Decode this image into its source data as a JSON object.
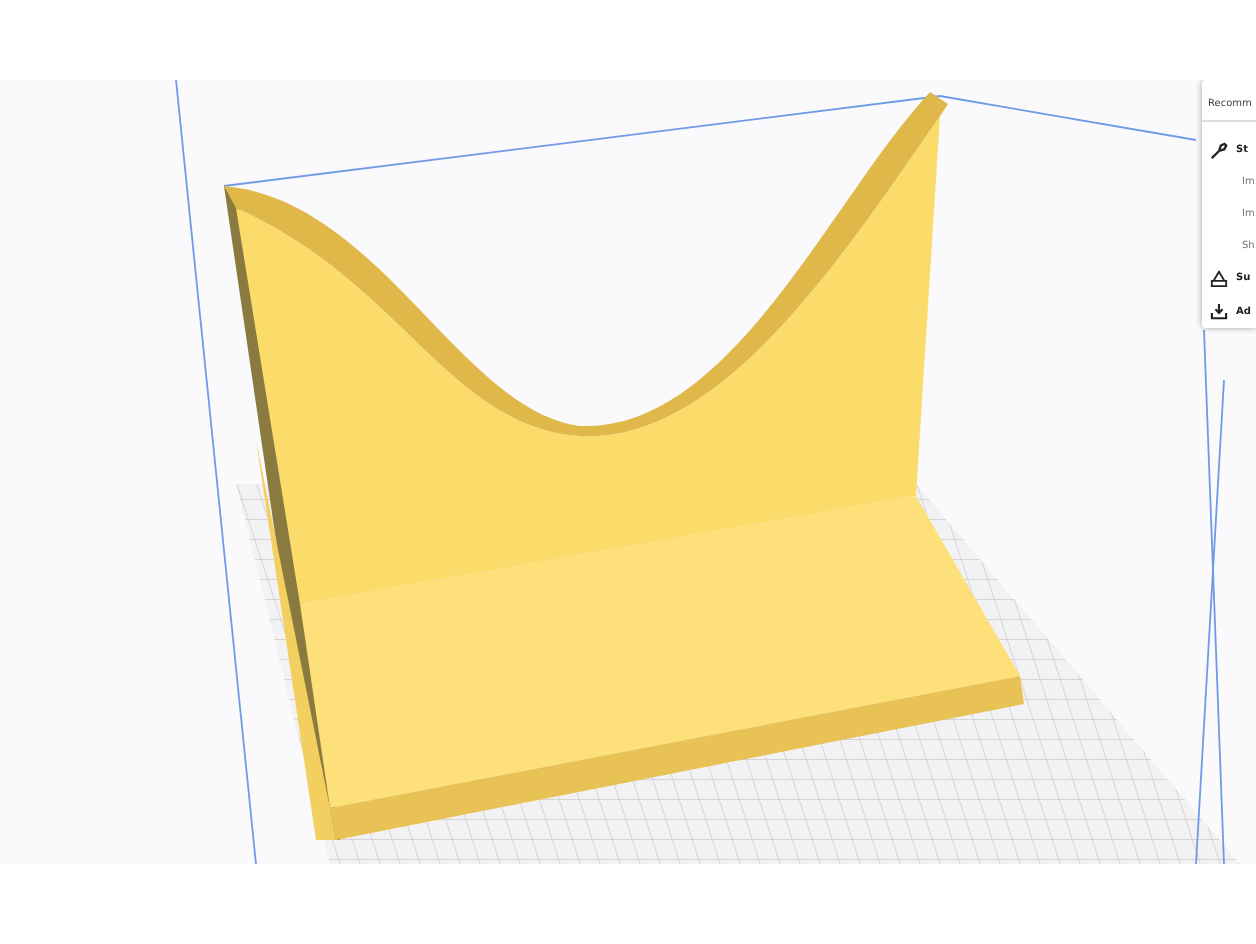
{
  "settings_panel": {
    "title": "Recomm",
    "items": [
      {
        "kind": "section",
        "label": "St"
      },
      {
        "kind": "option",
        "label": "Im"
      },
      {
        "kind": "option",
        "label": "Im"
      },
      {
        "kind": "option",
        "label": "Sh"
      },
      {
        "kind": "section",
        "label": "Su"
      },
      {
        "kind": "section",
        "label": "Ad"
      }
    ]
  }
}
